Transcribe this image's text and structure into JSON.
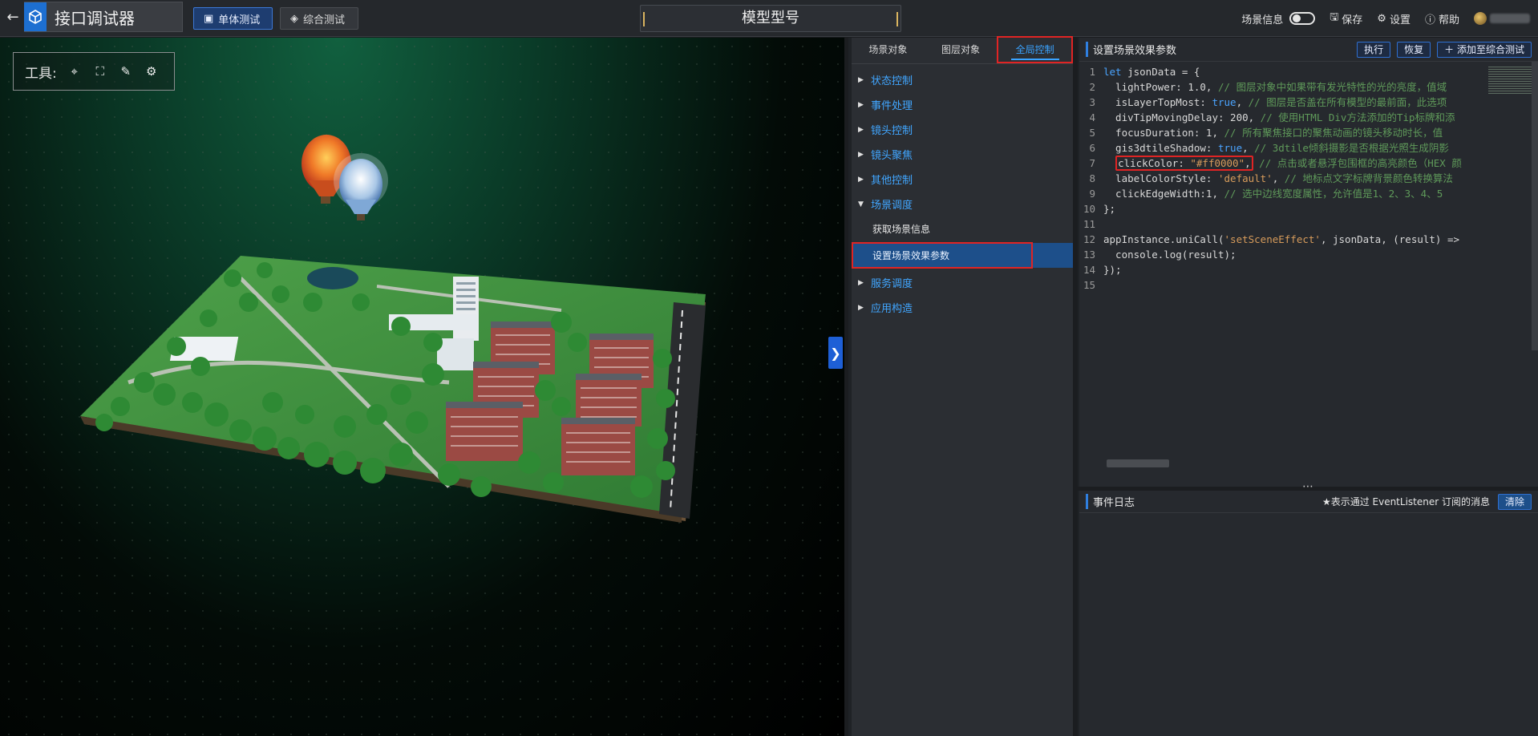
{
  "app": {
    "title": "接口调试器",
    "model_title": "模型型号"
  },
  "modes": {
    "single": "单体测试",
    "combined": "综合测试"
  },
  "nav": {
    "scene_info": "场景信息",
    "save": "保存",
    "settings": "设置",
    "help": "帮助"
  },
  "toolbox": {
    "label": "工具:"
  },
  "tabs": [
    "场景对象",
    "图层对象",
    "全局控制"
  ],
  "tree": {
    "n1": "状态控制",
    "n2": "事件处理",
    "n3": "镜头控制",
    "n4": "镜头聚焦",
    "n5": "其他控制",
    "n6": "场景调度",
    "leaf1": "获取场景信息",
    "leaf2": "设置场景效果参数",
    "n7": "服务调度",
    "n8": "应用构造"
  },
  "code": {
    "title": "设置场景效果参数",
    "run": "执行",
    "reset": "恢复",
    "add": "添加至综合测试",
    "lines": {
      "l1a": "let",
      "l1b": " jsonData = {",
      "l2a": "  lightPower: 1.0, ",
      "l2b": "// 图层对象中如果带有发光特性的光的亮度，值域",
      "l3a": "  isLayerTopMost: ",
      "l3b": "true",
      "l3c": ", ",
      "l3d": "// 图层是否盖在所有模型的最前面，此选项",
      "l4a": "  divTipMovingDelay: 200, ",
      "l4b": "// 使用HTML Div方法添加的Tip标牌和添",
      "l5a": "  focusDuration: 1, ",
      "l5b": "// 所有聚焦接口的聚焦动画的镜头移动时长，值",
      "l6a": "  gis3dtileShadow: ",
      "l6b": "true",
      "l6c": ", ",
      "l6d": "// 3dtile倾斜摄影是否根据光照生成阴影",
      "l7a": "  ",
      "l7b": "clickColor: ",
      "l7c": "\"#ff0000\"",
      "l7d": ",",
      "l7e": " // 点击或者悬浮包围框的高亮颜色（HEX 颜",
      "l8a": "  labelColorStyle: ",
      "l8b": "'default'",
      "l8c": ", ",
      "l8d": "// 地标点文字标牌背景颜色转换算法",
      "l9a": "  clickEdgeWidth:1, ",
      "l9b": "// 选中边线宽度属性，允许值是1、2、3、4、5",
      "l10": "};",
      "l11": "",
      "l12a": "appInstance.uniCall(",
      "l12b": "'setSceneEffect'",
      "l12c": ", jsonData, (result) =>",
      "l13": "  console.log(result);",
      "l14": "});",
      "l15": ""
    }
  },
  "log": {
    "title": "事件日志",
    "note": "★表示通过 EventListener 订阅的消息",
    "clear": "清除"
  }
}
